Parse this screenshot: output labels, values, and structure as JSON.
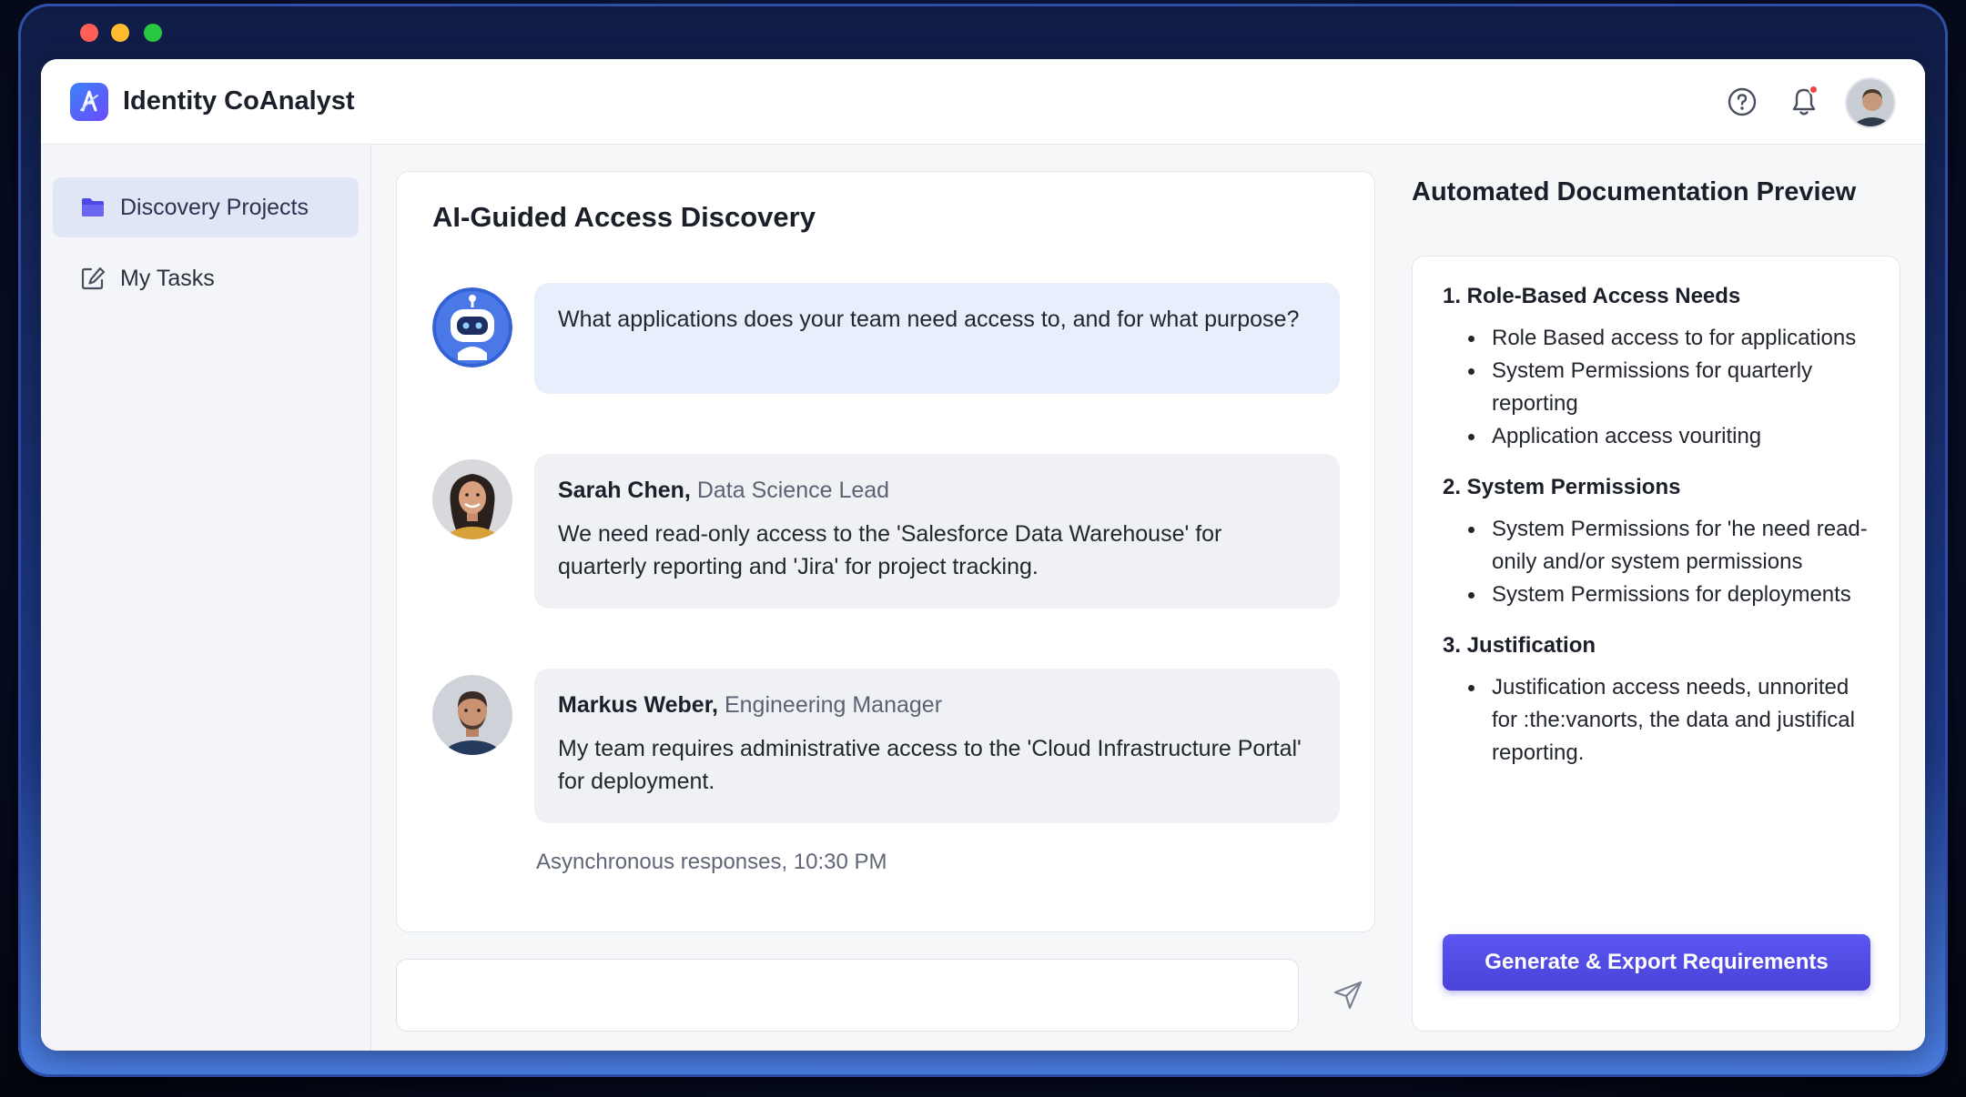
{
  "app": {
    "title": "Identity CoAnalyst",
    "accent_color": "#4f4ae6"
  },
  "header": {
    "icons": [
      "help-icon",
      "bell-icon",
      "user-avatar"
    ],
    "has_notification": true
  },
  "sidebar": {
    "items": [
      {
        "label": "Discovery Projects",
        "icon": "folder-icon",
        "active": true
      },
      {
        "label": "My Tasks",
        "icon": "edit-icon",
        "active": false
      }
    ]
  },
  "chat": {
    "title": "AI-Guided Access Discovery",
    "messages": [
      {
        "type": "ai",
        "avatar": "robot-icon",
        "text": "What applications does your team need access to, and for what purpose?"
      },
      {
        "type": "user",
        "name": "Sarah Chen,",
        "role": "Data Science Lead",
        "text": "We need read-only access to the 'Salesforce Data Warehouse' for quarterly reporting and 'Jira' for project tracking."
      },
      {
        "type": "user",
        "name": "Markus Weber,",
        "role": "Engineering Manager",
        "text": "My team requires administrative access to the 'Cloud Infrastructure Portal' for deployment."
      }
    ],
    "timestamp": "Asynchronous responses, 10:30 PM",
    "composer": {
      "placeholder": "",
      "send_icon": "send-icon"
    }
  },
  "doc_preview": {
    "title": "Automated Documentation Preview",
    "sections": [
      {
        "heading": "1. Role-Based Access Needs",
        "items": [
          "Role Based access to for applications",
          "System Permissions for quarterly reporting",
          "Application access vouriting"
        ]
      },
      {
        "heading": "2. System Permissions",
        "items": [
          "System Permissions for 'he need read-onily and/or system permissions",
          "System Permissions for deployments"
        ]
      },
      {
        "heading": "3. Justification",
        "items": [
          "Justification access needs, unnorited for :the:vanorts, the data and justifical reporting."
        ]
      }
    ],
    "export_button": "Generate & Export Requirements"
  }
}
